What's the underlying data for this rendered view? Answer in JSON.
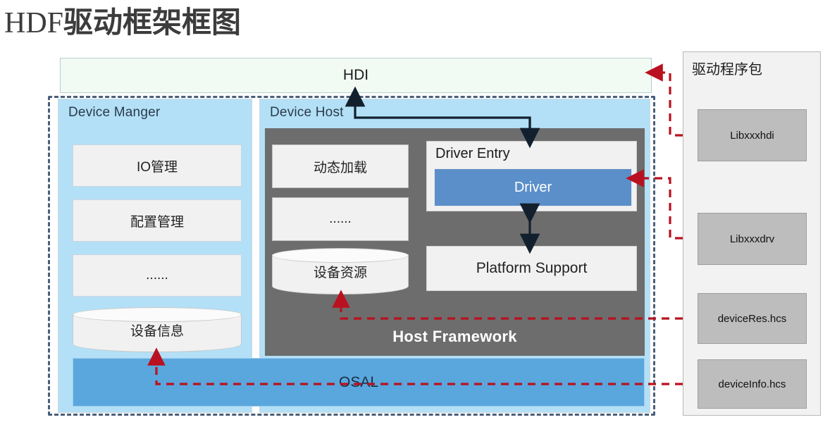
{
  "title": {
    "latin": "HDF",
    "cjk": "驱动框架框图"
  },
  "hdi": {
    "label": "HDI"
  },
  "device_manger": {
    "title": "Device Manger",
    "items": [
      {
        "label": "IO管理",
        "shape": "rect"
      },
      {
        "label": "配置管理",
        "shape": "rect"
      },
      {
        "label": "......",
        "shape": "rect"
      },
      {
        "label": "设备信息",
        "shape": "cylinder"
      }
    ]
  },
  "device_host": {
    "title": "Device Host",
    "framework_label": "Host Framework",
    "left_items": [
      {
        "label": "动态加载",
        "shape": "rect"
      },
      {
        "label": "......",
        "shape": "rect"
      },
      {
        "label": "设备资源",
        "shape": "cylinder"
      }
    ],
    "driver_entry": {
      "title": "Driver Entry",
      "driver_label": "Driver"
    },
    "platform_support": {
      "label": "Platform Support"
    }
  },
  "osal": {
    "label": "OSAL"
  },
  "driver_package": {
    "title": "驱动程序包",
    "items": [
      {
        "label": "Libxxxhdi"
      },
      {
        "label": "Libxxxdrv"
      },
      {
        "label": "deviceRes.hcs"
      },
      {
        "label": "deviceInfo.hcs"
      }
    ]
  },
  "colors": {
    "panel_blue": "#b3e0f7",
    "osal_blue": "#5aa7dd",
    "driver_blue": "#5b8fc9",
    "framework_gray": "#6d6d6d",
    "item_gray": "#f1f1f1",
    "pkg_item_gray": "#bdbdbd",
    "hdi_fill": "#f2faf4",
    "red_connector": "#b9111f",
    "blue_dashed": "#2a6fb5",
    "outer_dashed": "#4a5f7a",
    "black_arrow": "#12202e"
  }
}
